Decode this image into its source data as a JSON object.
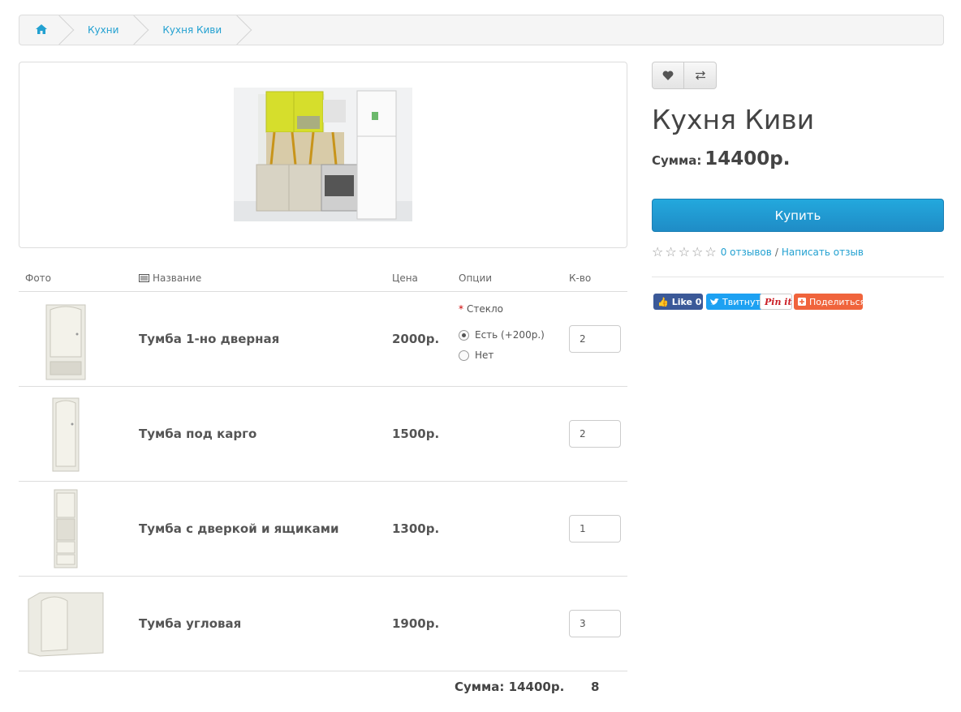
{
  "breadcrumb": {
    "items": [
      "Кухни",
      "Кухня Киви"
    ]
  },
  "table": {
    "headers": {
      "photo": "Фото",
      "name": "Название",
      "price": "Цена",
      "options": "Опции",
      "qty": "К-во"
    },
    "rows": [
      {
        "name": "Тумба 1-но дверная",
        "price": "2000р.",
        "qty": "2"
      },
      {
        "name": "Тумба под карго",
        "price": "1500р.",
        "qty": "2"
      },
      {
        "name": "Тумба с дверкой и ящиками",
        "price": "1300р.",
        "qty": "1"
      },
      {
        "name": "Тумба угловая",
        "price": "1900р.",
        "qty": "3"
      }
    ],
    "option": {
      "title": "Стекло",
      "choices": [
        "Есть (+200р.)",
        "Нет"
      ],
      "selected": 0
    },
    "total_label": "Сумма: 14400р.",
    "total_qty": "8"
  },
  "product": {
    "title": "Кухня Киви",
    "sum_label": "Сумма:",
    "sum_value": "14400р.",
    "buy_label": "Купить",
    "reviews_link": "0 отзывов",
    "write_review_link": "Написать отзыв",
    "rating": 0
  },
  "share": {
    "facebook": "Like 0",
    "twitter": "Твитнуть",
    "pinterest": "Pin it",
    "addthis": "Поделиться"
  },
  "colors": {
    "link": "#23a1d1",
    "buy": "#229ad6",
    "facebook": "#3b5998",
    "twitter": "#1da1f2",
    "addthis": "#f0643c"
  }
}
